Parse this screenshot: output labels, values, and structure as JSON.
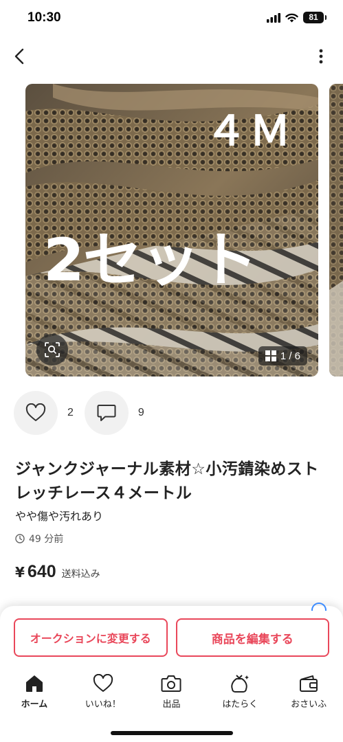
{
  "status": {
    "time": "10:30",
    "battery": "81"
  },
  "gallery": {
    "overlay_top": "４Ｍ",
    "overlay_main": "2セット",
    "counter": "1 / 6"
  },
  "actions": {
    "likes": "2",
    "comments": "9"
  },
  "item": {
    "title": "ジャンクジャーナル素材☆小汚錆染めストレッチレース４メートル",
    "condition": "やや傷や汚れあり",
    "posted": "49 分前",
    "currency": "¥",
    "price": "640",
    "shipping": "送料込み"
  },
  "buttons": {
    "auction": "オークションに変更する",
    "edit": "商品を編集する"
  },
  "tabs": [
    {
      "label": "ホーム",
      "icon": "home-icon"
    },
    {
      "label": "いいね！",
      "icon": "heart-icon"
    },
    {
      "label": "出品",
      "icon": "camera-icon"
    },
    {
      "label": "はたらく",
      "icon": "money-bag-icon"
    },
    {
      "label": "おさいふ",
      "icon": "wallet-icon"
    }
  ],
  "colors": {
    "accent": "#e9475a",
    "info": "#3b8bff"
  }
}
